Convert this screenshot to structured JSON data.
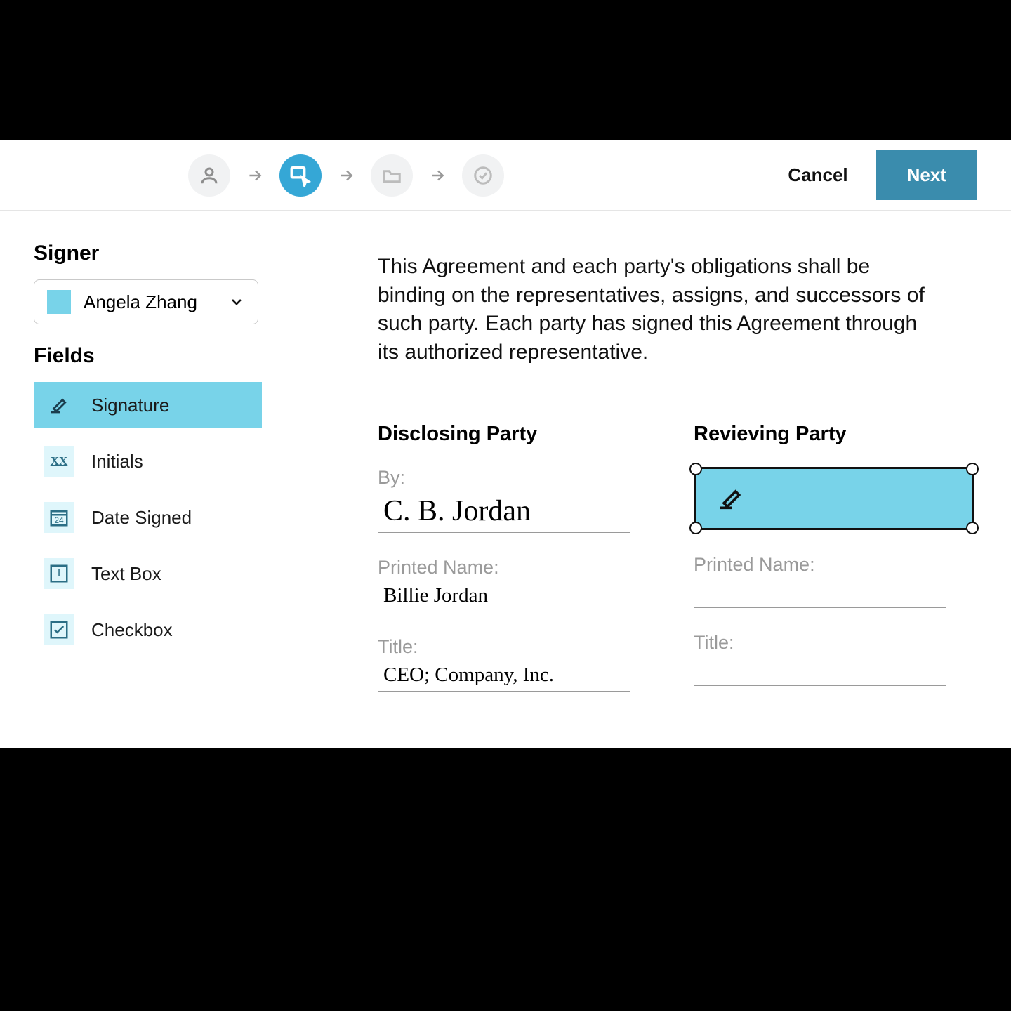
{
  "topbar": {
    "cancel_label": "Cancel",
    "next_label": "Next",
    "steps": [
      "person",
      "fields",
      "folder",
      "done"
    ],
    "active_step_index": 1
  },
  "sidebar": {
    "signer_heading": "Signer",
    "selected_signer": "Angela Zhang",
    "signer_color": "#78d3e9",
    "fields_heading": "Fields",
    "fields": [
      {
        "key": "signature",
        "label": "Signature",
        "active": true
      },
      {
        "key": "initials",
        "label": "Initials",
        "active": false,
        "iconText": "XX"
      },
      {
        "key": "date",
        "label": "Date Signed",
        "active": false,
        "iconText": "24"
      },
      {
        "key": "textbox",
        "label": "Text Box",
        "active": false,
        "iconText": "I"
      },
      {
        "key": "checkbox",
        "label": "Checkbox",
        "active": false
      }
    ]
  },
  "document": {
    "paragraph": "This Agreement and each party's obligations shall be binding on the representatives, assigns, and successors of such party. Each party has signed this Agreement through its authorized representative.",
    "disclosing": {
      "heading": "Disclosing Party",
      "by_label": "By:",
      "signature_text": "C. B. Jordan",
      "printed_label": "Printed Name:",
      "printed_value": "Billie Jordan",
      "title_label": "Title:",
      "title_value": "CEO; Company, Inc."
    },
    "receiving": {
      "heading": "Revieving Party",
      "printed_label": "Printed Name:",
      "printed_value": "",
      "title_label": "Title:",
      "title_value": ""
    }
  }
}
